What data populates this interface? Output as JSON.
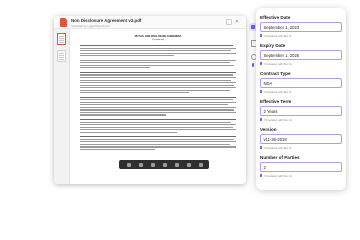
{
  "document": {
    "title": "Non Disclosure Agreement v3.pdf",
    "subtitle": "Uploaded by Legal Department",
    "close_glyph": "✕",
    "heading": "MUTUAL NON-DISCLOSURE AGREEMENT",
    "subheading": "(Confidential)"
  },
  "toolbar": {
    "items": [
      {
        "icon": "fields-icon",
        "active": true
      },
      {
        "icon": "document-icon",
        "active": false
      },
      {
        "icon": "search-icon",
        "active": false
      },
      {
        "icon": "info-icon",
        "active": true
      }
    ]
  },
  "panel": {
    "fields": [
      {
        "label": "Effective Date",
        "value": "September 1, 2023",
        "hint": "Populated with Box AI"
      },
      {
        "label": "Expiry Date",
        "value": "September 1, 2025",
        "hint": "Populated with Box AI"
      },
      {
        "label": "Contract Type",
        "value": "NDA",
        "hint": "Populated with Box AI"
      },
      {
        "label": "Effective Term",
        "value": "2 Years",
        "hint": "Populated with Box AI"
      },
      {
        "label": "Version",
        "value": "v11-26-2018",
        "hint": "Populated with Box AI"
      },
      {
        "label": "Number of Parties",
        "value": "2",
        "hint": "Populated with Box AI"
      }
    ]
  },
  "colors": {
    "accent": "#7b5cf2",
    "pdf_icon": "#e5533d"
  }
}
